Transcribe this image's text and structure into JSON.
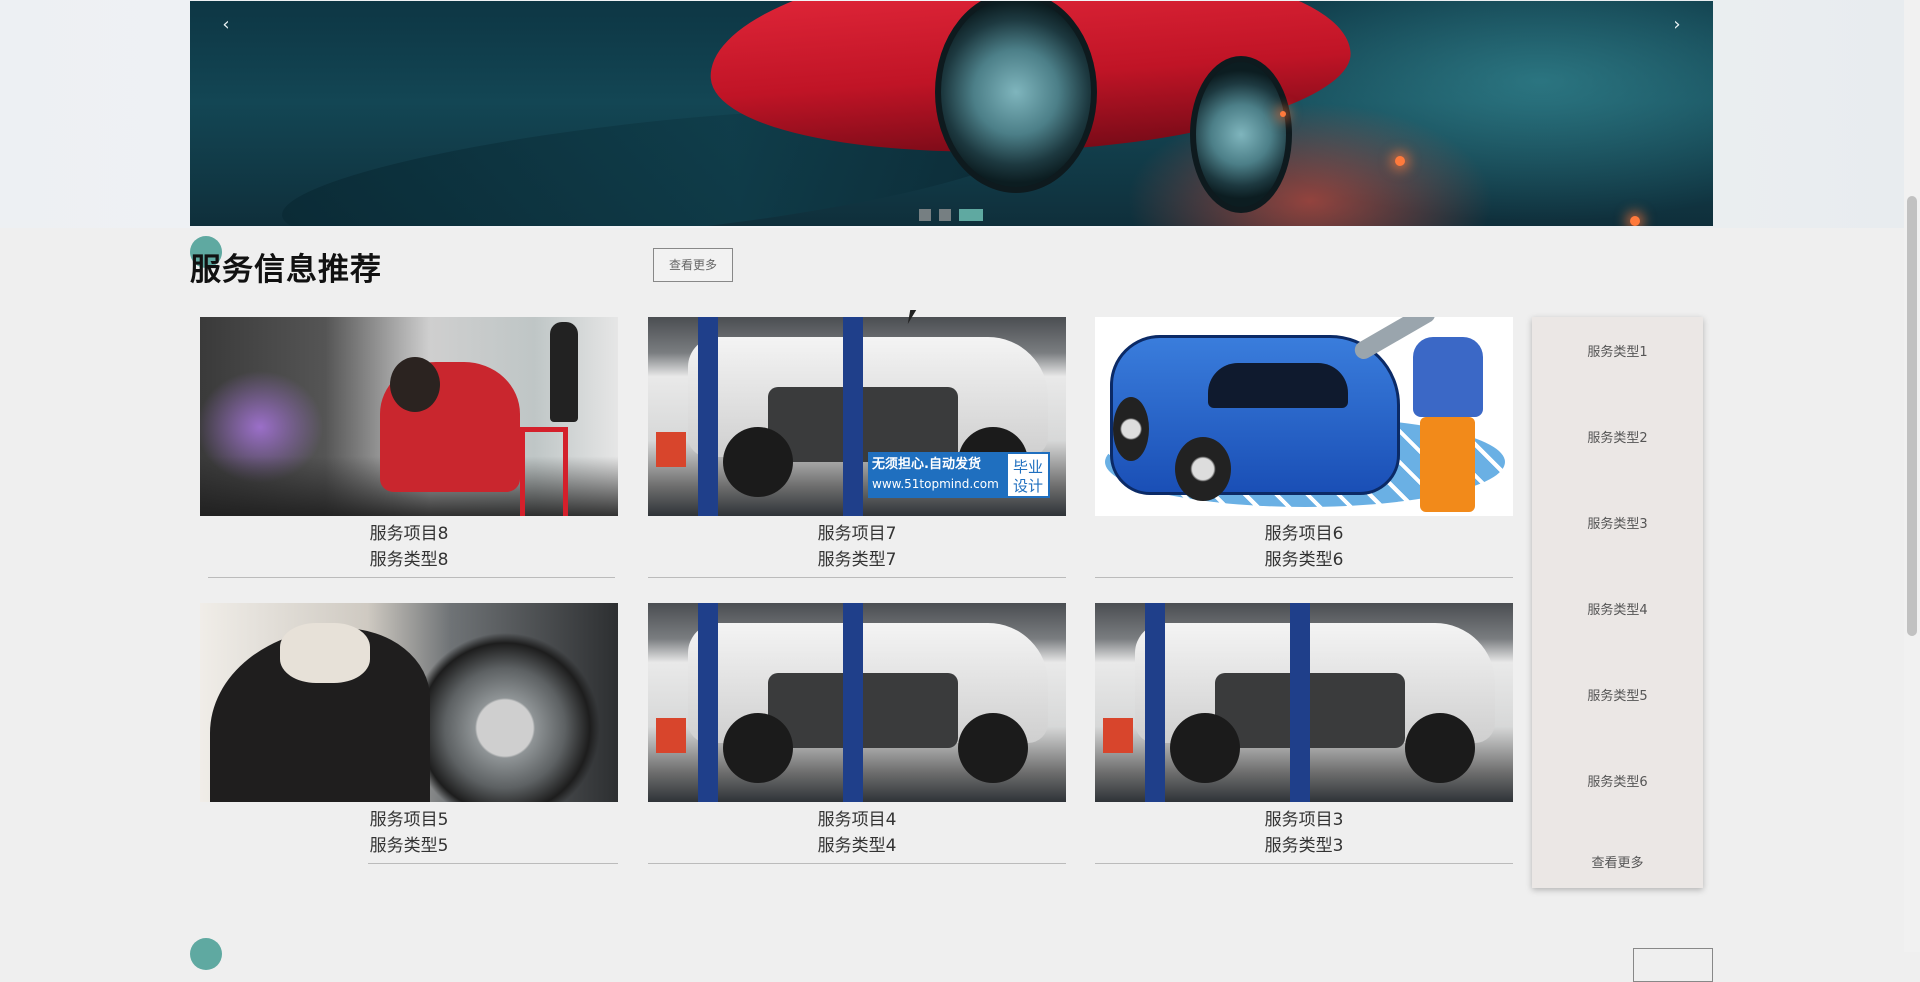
{
  "banner": {
    "prev_icon": "‹",
    "next_icon": "›",
    "dots": [
      {
        "active": false
      },
      {
        "active": false
      },
      {
        "active": true
      }
    ]
  },
  "section": {
    "title": "服务信息推荐",
    "more_label": "查看更多"
  },
  "cards": [
    {
      "name": "服务项目8",
      "type": "服务类型8",
      "image": "mechanic-engine-photo"
    },
    {
      "name": "服务项目7",
      "type": "服务类型7",
      "image": "car-on-lift-photo"
    },
    {
      "name": "服务项目6",
      "type": "服务类型6",
      "image": "cartoon-car-mechanic"
    },
    {
      "name": "服务项目5",
      "type": "服务类型5",
      "image": "wheel-alignment-photo"
    },
    {
      "name": "服务项目4",
      "type": "服务类型4",
      "image": "car-on-lift-photo"
    },
    {
      "name": "服务项目3",
      "type": "服务类型3",
      "image": "car-on-lift-photo"
    }
  ],
  "watermark": {
    "line1": "无须担心.自动发货",
    "line2": "www.51topmind.com",
    "right_top": "毕业",
    "right_bottom": "设计"
  },
  "sidebar": {
    "items": [
      "服务类型1",
      "服务类型2",
      "服务类型3",
      "服务类型4",
      "服务类型5",
      "服务类型6"
    ],
    "more_label": "查看更多"
  },
  "colors": {
    "accent": "#5fa9a1",
    "page_bg": "#efefef",
    "sidebar_bg": "#ebe7e5"
  }
}
